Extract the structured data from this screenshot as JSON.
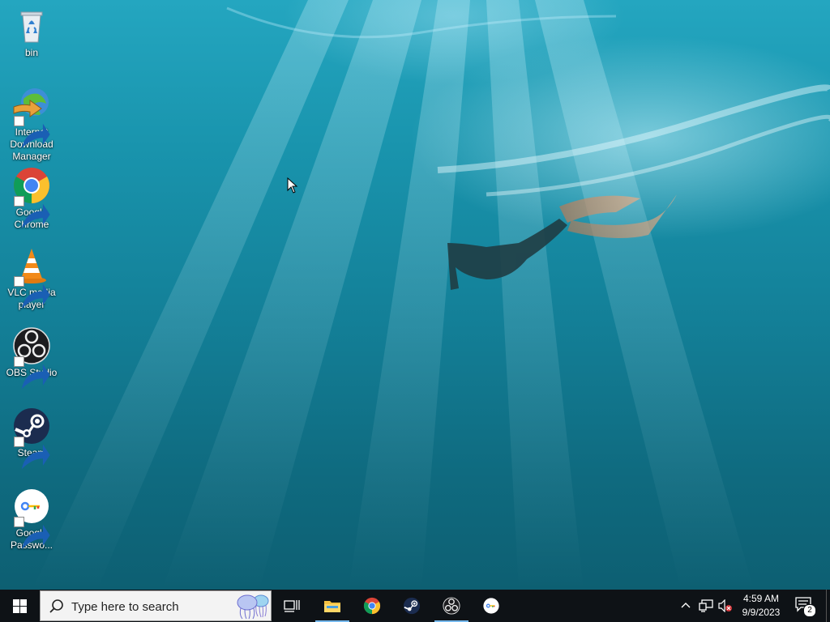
{
  "desktop": {
    "icons": [
      {
        "label": "bin",
        "icon": "recycle-bin-icon"
      },
      {
        "label": "Internet Download Manager",
        "icon": "idm-icon"
      },
      {
        "label": "Google Chrome",
        "icon": "chrome-icon"
      },
      {
        "label": "VLC media player",
        "icon": "vlc-icon"
      },
      {
        "label": "OBS Studio",
        "icon": "obs-icon"
      },
      {
        "label": "Steam",
        "icon": "steam-icon"
      },
      {
        "label": "Google Passwo...",
        "icon": "google-password-icon"
      }
    ]
  },
  "taskbar": {
    "search_placeholder": "Type here to search",
    "pinned": [
      {
        "name": "task-view",
        "icon": "task-view-icon",
        "running": false
      },
      {
        "name": "file-explorer",
        "icon": "folder-icon",
        "running": true
      },
      {
        "name": "google-chrome",
        "icon": "chrome-icon",
        "running": false
      },
      {
        "name": "steam",
        "icon": "steam-icon",
        "running": false
      },
      {
        "name": "obs-studio",
        "icon": "obs-icon",
        "running": true
      },
      {
        "name": "google-password",
        "icon": "google-password-icon",
        "running": false
      }
    ],
    "clock": {
      "time": "4:59 AM",
      "date": "9/9/2023"
    },
    "notifications_count": "2"
  },
  "colors": {
    "taskbar": "#0e1216",
    "running_indicator": "#76b9ed",
    "wallpaper_top": "#24a6c0",
    "wallpaper_bottom": "#0d5f72"
  }
}
